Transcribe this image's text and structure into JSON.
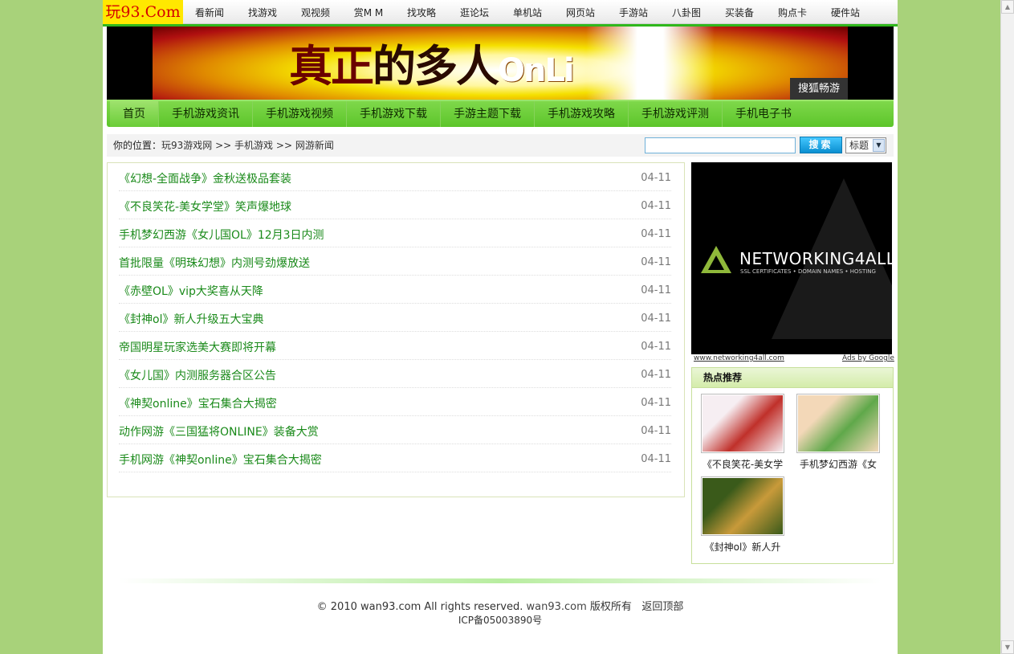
{
  "logo": "玩93.Com",
  "top_nav": [
    "看新闻",
    "找游戏",
    "观视频",
    "赏M M",
    "找攻略",
    "逛论坛",
    "单机站",
    "网页站",
    "手游站",
    "八卦图",
    "买装备",
    "购点卡",
    "硬件站"
  ],
  "banner": {
    "text_part1": "真正",
    "text_part2": "的多人",
    "text_part3": "OnLi",
    "tag": "搜狐畅游"
  },
  "main_nav": [
    "首页",
    "手机游戏资讯",
    "手机游戏视频",
    "手机游戏下载",
    "手游主题下载",
    "手机游戏攻略",
    "手机游戏评测",
    "手机电子书"
  ],
  "breadcrumb": {
    "label": "你的位置：",
    "items": [
      "玩93游戏网",
      " >> 手机游戏",
      " >> 网游新闻"
    ]
  },
  "search": {
    "button": "搜索",
    "select_value": "标题"
  },
  "articles": [
    {
      "title": "《幻想-全面战争》金秋送极品套装",
      "date": "04-11"
    },
    {
      "title": "《不良笑花-美女学堂》笑声爆地球",
      "date": "04-11"
    },
    {
      "title": "手机梦幻西游《女儿国OL》12月3日内测",
      "date": "04-11"
    },
    {
      "title": "首批限量《明珠幻想》内测号劲爆放送",
      "date": "04-11"
    },
    {
      "title": "《赤壁OL》vip大奖喜从天降",
      "date": "04-11"
    },
    {
      "title": "《封神ol》新人升级五大宝典",
      "date": "04-11"
    },
    {
      "title": "帝国明星玩家选美大赛即将开幕",
      "date": "04-11"
    },
    {
      "title": "《女儿国》内测服务器合区公告",
      "date": "04-11"
    },
    {
      "title": "《神契online》宝石集合大揭密",
      "date": "04-11"
    },
    {
      "title": "动作网游《三国猛将ONLINE》装备大赏",
      "date": "04-11"
    },
    {
      "title": "手机网游《神契online》宝石集合大揭密",
      "date": "04-11"
    }
  ],
  "ad": {
    "name": "NETWORKING4ALL",
    "sub": "SSL CERTIFICATES • DOMAIN NAMES • HOSTING",
    "link": "www.networking4all.com",
    "by": "Ads by Google"
  },
  "hot": {
    "title": "热点推荐",
    "items": [
      {
        "caption": "《不良笑花-美女学",
        "colors": [
          "#f6eef2",
          "#c0302a"
        ]
      },
      {
        "caption": "手机梦幻西游《女",
        "colors": [
          "#f3d8b8",
          "#5fa84a"
        ]
      },
      {
        "caption": "《封神ol》新人升",
        "colors": [
          "#3a5a1a",
          "#c89a3a"
        ]
      }
    ]
  },
  "footer": {
    "copyright": "© 2010 wan93.com All rights reserved.",
    "site": "wan93.com",
    "rights": "版权所有",
    "back_top": "返回顶部",
    "icp": "ICP备05003890号"
  },
  "colors": {
    "page_bg": "#a8d27a",
    "accent_green": "#5cc52a",
    "link_green": "#1a8a1a"
  }
}
